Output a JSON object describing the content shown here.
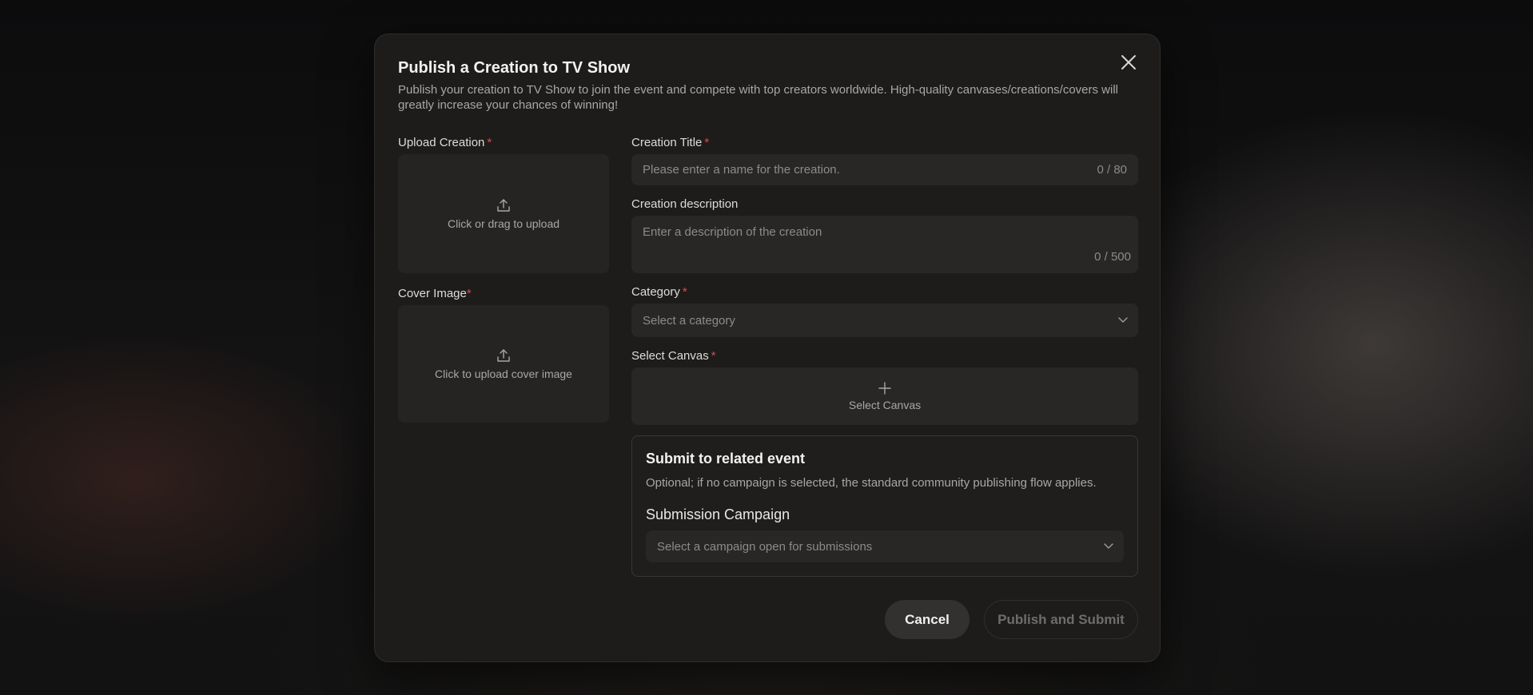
{
  "modal": {
    "title": "Publish a Creation to TV Show",
    "subtitle": "Publish your creation to TV Show to join the event and compete with top creators worldwide. High-quality canvases/creations/covers will greatly increase your chances of winning!",
    "close_icon": "close-icon"
  },
  "upload_creation": {
    "label": "Upload Creation",
    "required_mark": "*",
    "icon": "upload-icon",
    "text": "Click or drag to upload"
  },
  "cover_image": {
    "label": "Cover Image",
    "required_mark": "*",
    "icon": "upload-icon",
    "text": "Click to upload cover image"
  },
  "creation_title": {
    "label": "Creation Title",
    "required_mark": "*",
    "placeholder": "Please enter a name for the creation.",
    "counter": "0 / 80"
  },
  "creation_description": {
    "label": "Creation description",
    "placeholder": "Enter a description of the creation",
    "counter": "0 / 500"
  },
  "category": {
    "label": "Category",
    "required_mark": "*",
    "placeholder": "Select a category",
    "icon": "chevron-down-icon"
  },
  "select_canvas": {
    "label": "Select Canvas",
    "required_mark": "*",
    "icon": "plus-icon",
    "text": "Select Canvas"
  },
  "event": {
    "title": "Submit to related event",
    "description": "Optional; if no campaign is selected, the standard community publishing flow applies.",
    "campaign_label": "Submission Campaign",
    "campaign_placeholder": "Select a campaign open for submissions",
    "icon": "chevron-down-icon"
  },
  "buttons": {
    "cancel": "Cancel",
    "publish": "Publish and Submit"
  },
  "colors": {
    "required": "#e0474c",
    "modal_bg": "#1d1c1b",
    "field_bg": "#282726"
  }
}
